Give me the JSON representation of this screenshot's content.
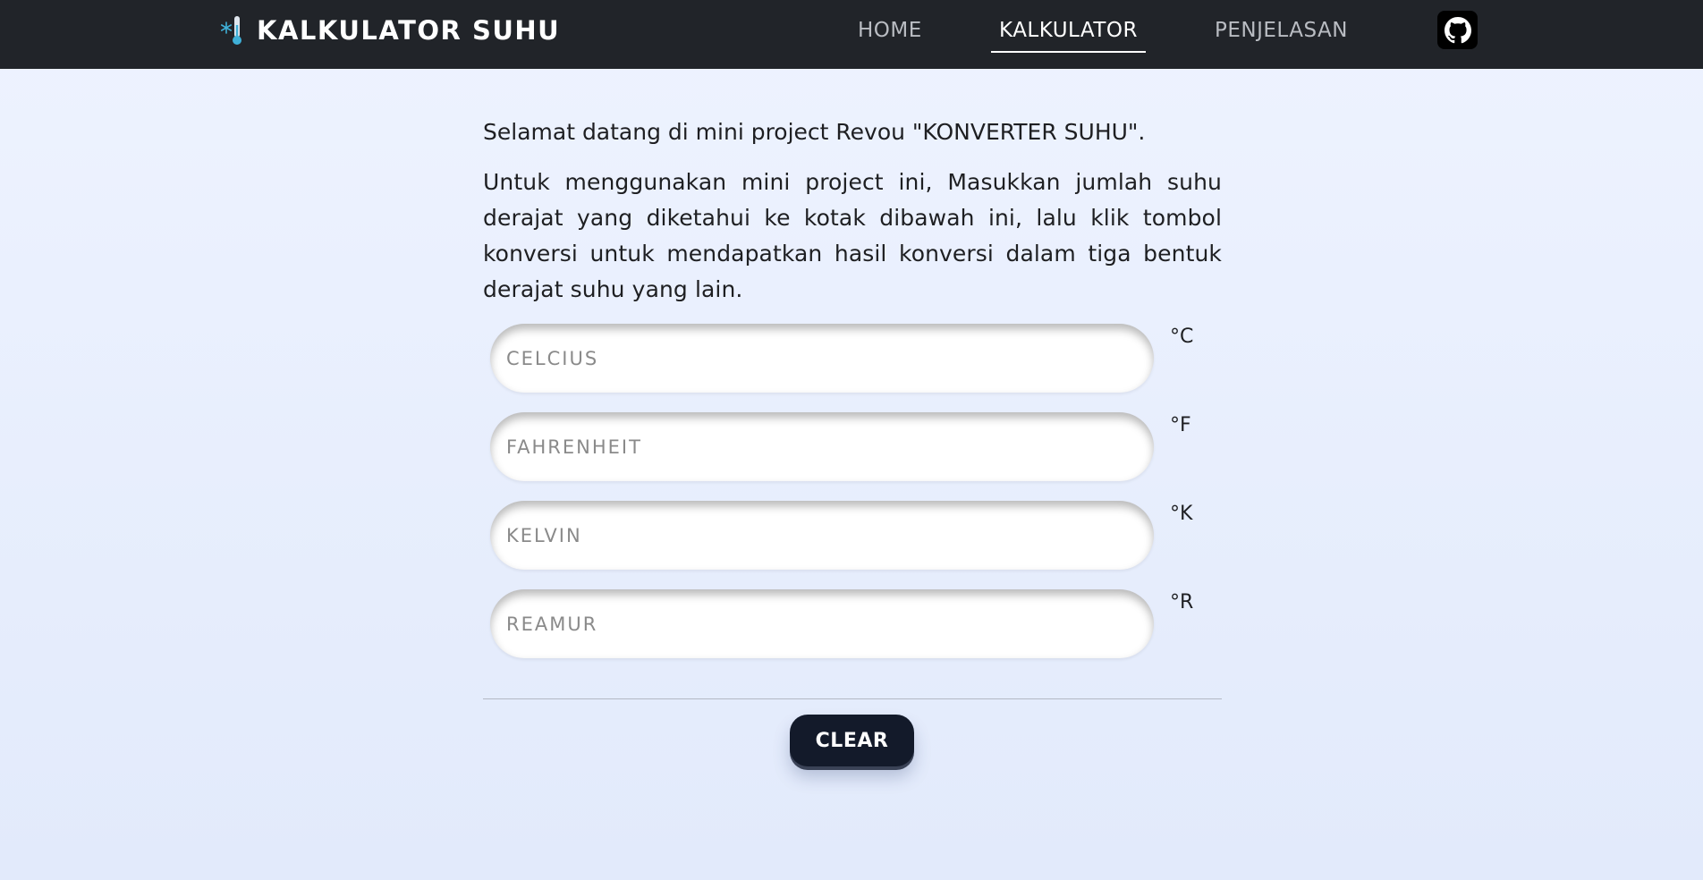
{
  "navbar": {
    "brand_icon": "thermometer-snowflake-icon",
    "brand_title": "KALKULATOR SUHU",
    "links": {
      "home": "HOME",
      "kalkulator": "KALKULATOR",
      "penjelasan": "PENJELASAN"
    },
    "active_link": "KALKULATOR",
    "github_icon": "github-icon"
  },
  "intro": {
    "paragraph_1": "Selamat datang di mini project Revou \"KONVERTER SUHU\".",
    "paragraph_2": "Untuk menggunakan mini project ini, Masukkan jumlah suhu derajat yang diketahui ke kotak dibawah ini, lalu klik tombol konversi untuk mendapatkan hasil konversi dalam tiga bentuk derajat suhu yang lain."
  },
  "fields": [
    {
      "placeholder": "CELCIUS",
      "value": "",
      "unit": "°C"
    },
    {
      "placeholder": "FAHRENHEIT",
      "value": "",
      "unit": "°F"
    },
    {
      "placeholder": "KELVIN",
      "value": "",
      "unit": "°K"
    },
    {
      "placeholder": "REAMUR",
      "value": "",
      "unit": "°R"
    }
  ],
  "actions": {
    "clear_label": "CLEAR"
  },
  "colors": {
    "navbar_bg": "#212429",
    "button_bg": "#131a2a",
    "page_bg_top": "#eef3ff",
    "page_bg_bottom": "#e2eafb",
    "thermometer_accent": "#3fb0d8"
  }
}
